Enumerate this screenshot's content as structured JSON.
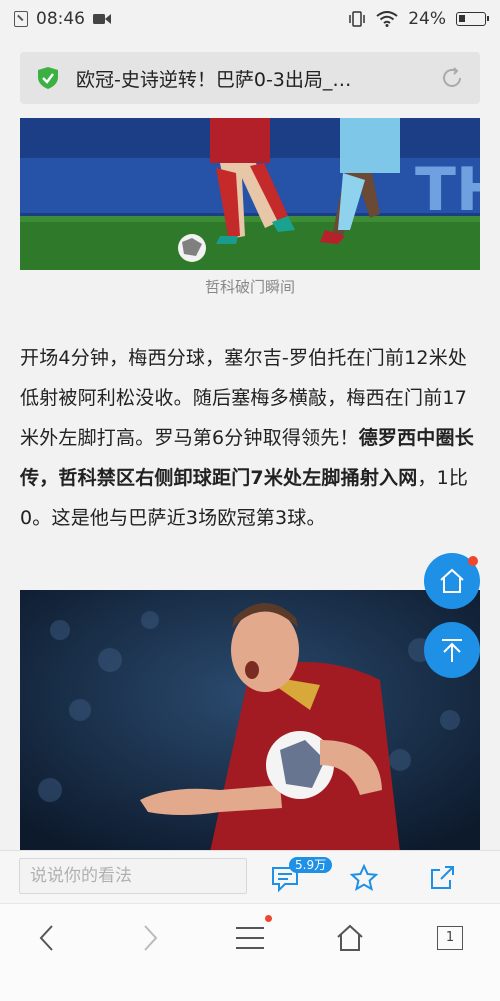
{
  "status_bar": {
    "time": "08:46",
    "battery": "24%"
  },
  "address_bar": {
    "title": "欧冠-史诗逆转！巴萨0-3出局_…"
  },
  "article": {
    "caption": "哲科破门瞬间",
    "para_part1": "开场4分钟，梅西分球，塞尔吉-罗伯托在门前12米处低射被阿利松没收。随后塞梅多横敲，梅西在门前17米外左脚打高。罗马第6分钟取得领先！",
    "para_bold": "德罗西中圈长传，哲科禁区右侧卸球距门7米处左脚捅射入网",
    "para_part2": "，1比0。这是他与巴萨近3场欧冠第3球。"
  },
  "comment_bar": {
    "placeholder": "说说你的看法",
    "comment_count": "5.9万"
  },
  "bottom_nav": {
    "tab_count": "1"
  },
  "colors": {
    "accent": "#1e90e6",
    "dot": "#f0452f",
    "shield": "#3cb043"
  }
}
